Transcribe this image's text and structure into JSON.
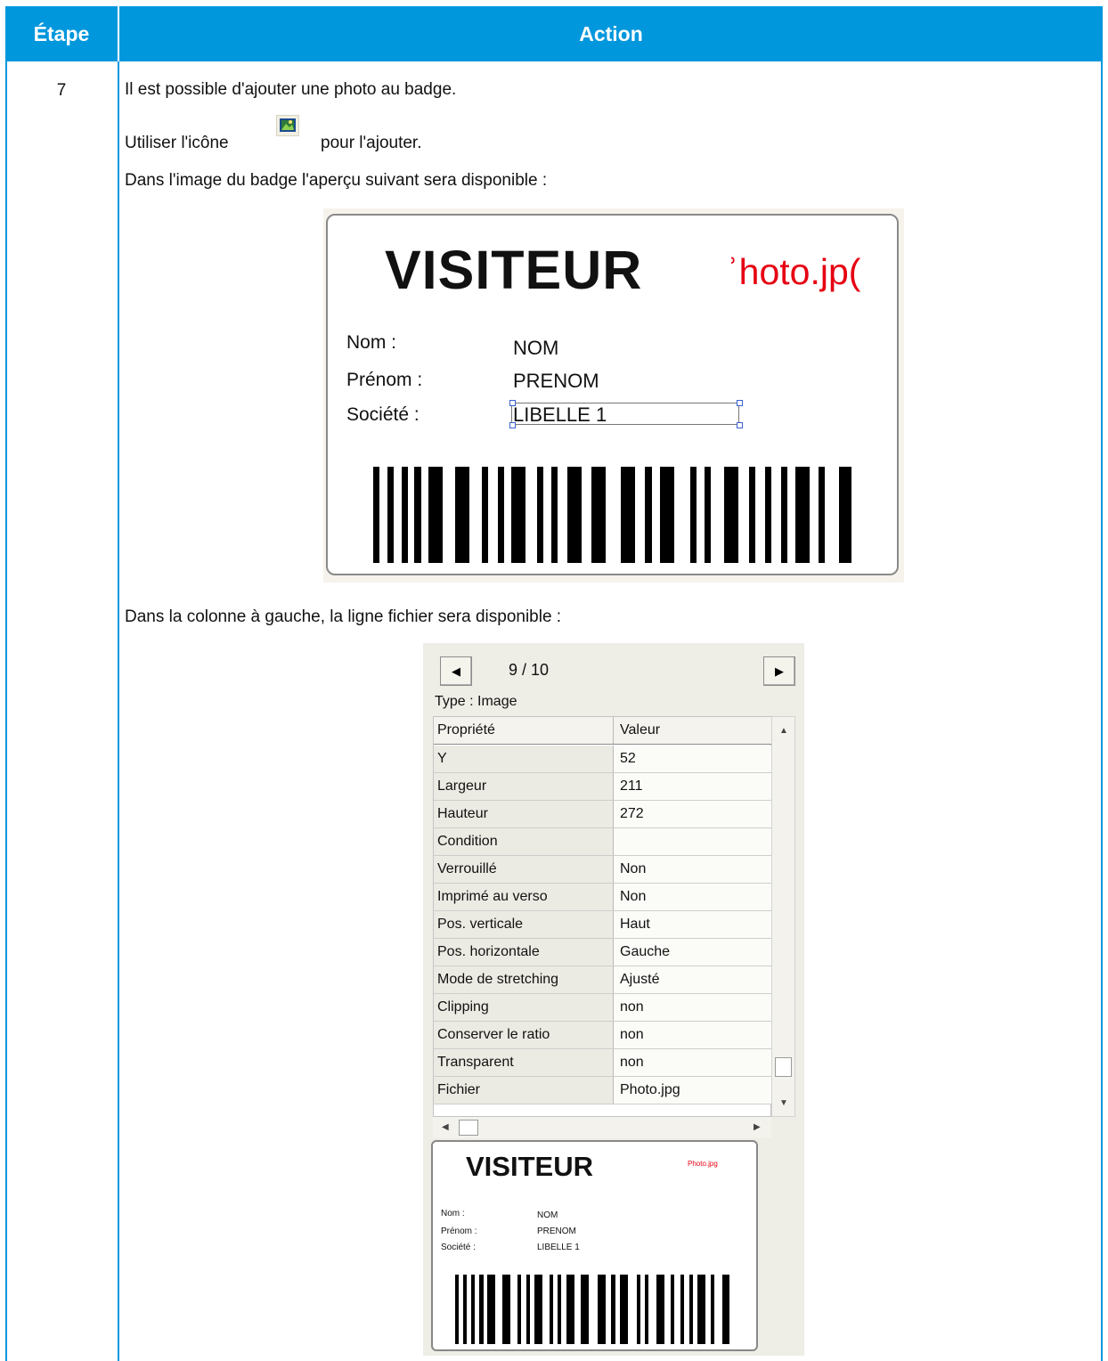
{
  "table": {
    "header": {
      "step": "Étape",
      "action": "Action"
    },
    "row": {
      "step": "7",
      "paragraphs": {
        "p1": "Il est possible d'ajouter une photo au badge.",
        "p2_before": "Utiliser l'icône",
        "p2_after": "pour l'ajouter.",
        "p3": "Dans l'image du badge l'aperçu suivant sera disponible :",
        "p4": "Dans la colonne à gauche, la ligne fichier sera disponible :"
      }
    },
    "header_color": "#0097dd"
  },
  "badge": {
    "title": "VISITEUR",
    "photo_text": "ʾhoto.jp(",
    "photo_color": "#e60012",
    "fields": [
      {
        "label": "Nom :",
        "value": "NOM"
      },
      {
        "label": "Prénom :",
        "value": "PRENOM"
      },
      {
        "label": "Société :",
        "value": "LIBELLE 1"
      }
    ]
  },
  "panel": {
    "pager": "9 / 10",
    "type_label": "Type : Image",
    "columns": {
      "property": "Propriété",
      "value": "Valeur"
    },
    "rows": [
      {
        "property": "Y",
        "value": "52"
      },
      {
        "property": "Largeur",
        "value": "211"
      },
      {
        "property": "Hauteur",
        "value": "272"
      },
      {
        "property": "Condition",
        "value": ""
      },
      {
        "property": "Verrouillé",
        "value": "Non"
      },
      {
        "property": "Imprimé au verso",
        "value": "Non"
      },
      {
        "property": "Pos. verticale",
        "value": "Haut"
      },
      {
        "property": "Pos. horizontale",
        "value": "Gauche"
      },
      {
        "property": "Mode de stretching",
        "value": "Ajusté"
      },
      {
        "property": "Clipping",
        "value": "non"
      },
      {
        "property": "Conserver le ratio",
        "value": "non"
      },
      {
        "property": "Transparent",
        "value": "non"
      },
      {
        "property": "Fichier",
        "value": "Photo.jpg"
      }
    ],
    "mini_badge": {
      "title": "VISITEUR",
      "photo_text": "Photo.jpg",
      "fields": [
        {
          "label": "Nom :",
          "value": "NOM"
        },
        {
          "label": "Prénom :",
          "value": "PRENOM"
        },
        {
          "label": "Société :",
          "value": "LIBELLE 1"
        }
      ]
    }
  },
  "icons": {
    "add_photo": "picture-icon",
    "prev": "triangle-left-icon",
    "next": "triangle-right-icon"
  }
}
